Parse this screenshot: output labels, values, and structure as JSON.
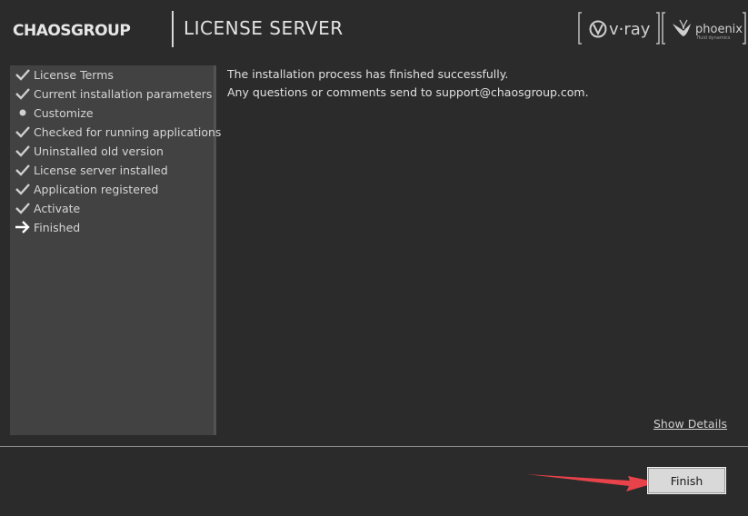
{
  "header": {
    "brand": "CHAOSGROUP",
    "product": "LICENSE SERVER",
    "partner_logos": [
      "vray-logo",
      "phoenix-logo"
    ],
    "vray_text": "v·ray",
    "phoenix_text": "phoenix",
    "phoenix_sub": "fluid dynamics"
  },
  "steps": [
    {
      "label": "License Terms",
      "icon": "check-icon"
    },
    {
      "label": "Current installation parameters",
      "icon": "check-icon"
    },
    {
      "label": "Customize",
      "icon": "bullet-icon"
    },
    {
      "label": "Checked for running applications",
      "icon": "check-icon"
    },
    {
      "label": "Uninstalled old version",
      "icon": "check-icon"
    },
    {
      "label": "License server installed",
      "icon": "check-icon"
    },
    {
      "label": "Application registered",
      "icon": "check-icon"
    },
    {
      "label": "Activate",
      "icon": "check-icon"
    },
    {
      "label": "Finished",
      "icon": "arrow-right-icon"
    }
  ],
  "content": {
    "line1": "The installation process has finished successfully.",
    "line2": "Any questions or comments send to support@chaosgroup.com."
  },
  "show_details_label": "Show Details",
  "finish_label": "Finish",
  "colors": {
    "background": "#2b2b2b",
    "sidebar": "#424242",
    "annotation_arrow": "#e8424a"
  }
}
